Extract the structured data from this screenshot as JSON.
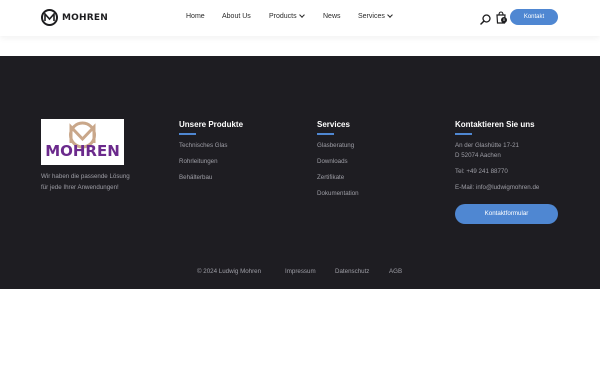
{
  "header": {
    "brand": "MOHREN",
    "nav": [
      {
        "label": "Home"
      },
      {
        "label": "About Us"
      },
      {
        "label": "Products"
      },
      {
        "label": "News"
      },
      {
        "label": "Services"
      }
    ],
    "cart_count": "0",
    "kontakt_label": "Kontakt",
    "icons": [
      "mohren-logo-icon",
      "search-icon",
      "cart-icon",
      "chevron-down-icon"
    ]
  },
  "footer": {
    "brand_image_text": "MOHREN",
    "tagline": "Wir haben die passende Lösung für jede Ihrer Anwendungen!",
    "produkte": {
      "title": "Unsere Produkte",
      "links": [
        "Technisches Glas",
        "Rohrleitungen",
        "Behälterbau"
      ]
    },
    "services": {
      "title": "Services",
      "links": [
        "Glasberatung",
        "Downloads",
        "Zertifikate",
        "Dokumentation"
      ]
    },
    "kontakt": {
      "title": "Kontaktieren Sie uns",
      "address_line1": "An der Glashütte 17-21",
      "address_line2": "D 52074 Aachen",
      "phone": "Tel: +49 241 88770",
      "email": "E-Mail: info@ludwigmohren.de",
      "form_button": "Kontaktformular"
    },
    "bottom": {
      "copyright": "© 2024 Ludwig Mohren",
      "links": [
        "Impressum",
        "Datenschutz",
        "AGB"
      ]
    }
  },
  "colors": {
    "accent": "#4f87d2",
    "footer_bg": "#1e1d22",
    "logo_purple": "#6b2a8c",
    "logo_tan": "#c9a78a"
  }
}
